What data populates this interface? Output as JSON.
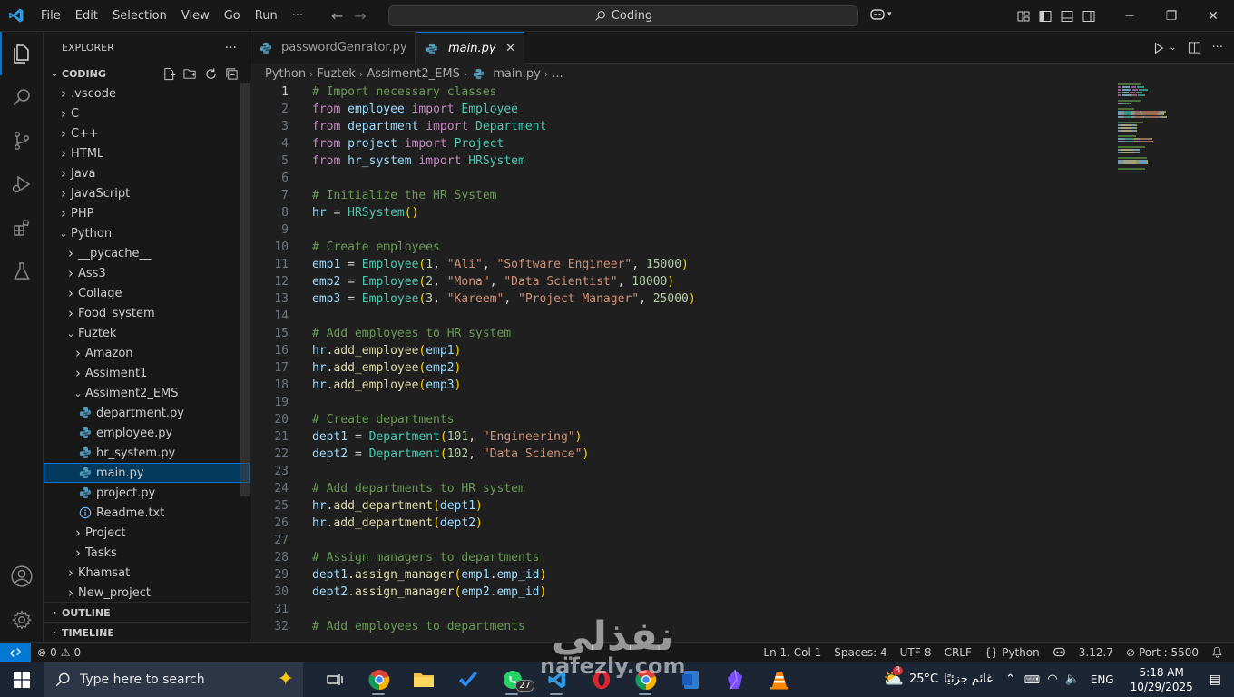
{
  "titlebar": {
    "menu": [
      "File",
      "Edit",
      "Selection",
      "View",
      "Go",
      "Run",
      "···"
    ],
    "command_center": "Coding",
    "window_controls": [
      "minimize-icon",
      "restore-icon",
      "close-icon"
    ]
  },
  "explorer": {
    "title": "EXPLORER",
    "more": "···",
    "root": "CODING",
    "tree": [
      {
        "label": ".vscode",
        "type": "folder",
        "depth": 0,
        "open": false
      },
      {
        "label": "C",
        "type": "folder",
        "depth": 0,
        "open": false
      },
      {
        "label": "C++",
        "type": "folder",
        "depth": 0,
        "open": false
      },
      {
        "label": "HTML",
        "type": "folder",
        "depth": 0,
        "open": false
      },
      {
        "label": "Java",
        "type": "folder",
        "depth": 0,
        "open": false
      },
      {
        "label": "JavaScript",
        "type": "folder",
        "depth": 0,
        "open": false
      },
      {
        "label": "PHP",
        "type": "folder",
        "depth": 0,
        "open": false
      },
      {
        "label": "Python",
        "type": "folder",
        "depth": 0,
        "open": true
      },
      {
        "label": "__pycache__",
        "type": "folder",
        "depth": 1,
        "open": false
      },
      {
        "label": "Ass3",
        "type": "folder",
        "depth": 1,
        "open": false
      },
      {
        "label": "Collage",
        "type": "folder",
        "depth": 1,
        "open": false
      },
      {
        "label": "Food_system",
        "type": "folder",
        "depth": 1,
        "open": false
      },
      {
        "label": "Fuztek",
        "type": "folder",
        "depth": 1,
        "open": true
      },
      {
        "label": "Amazon",
        "type": "folder",
        "depth": 2,
        "open": false
      },
      {
        "label": "Assiment1",
        "type": "folder",
        "depth": 2,
        "open": false
      },
      {
        "label": "Assiment2_EMS",
        "type": "folder",
        "depth": 2,
        "open": true
      },
      {
        "label": "department.py",
        "type": "python",
        "depth": 3
      },
      {
        "label": "employee.py",
        "type": "python",
        "depth": 3
      },
      {
        "label": "hr_system.py",
        "type": "python",
        "depth": 3
      },
      {
        "label": "main.py",
        "type": "python",
        "depth": 3,
        "selected": true
      },
      {
        "label": "project.py",
        "type": "python",
        "depth": 3
      },
      {
        "label": "Readme.txt",
        "type": "text",
        "depth": 3
      },
      {
        "label": "Project",
        "type": "folder",
        "depth": 2,
        "open": false
      },
      {
        "label": "Tasks",
        "type": "folder",
        "depth": 2,
        "open": false
      },
      {
        "label": "Khamsat",
        "type": "folder",
        "depth": 1,
        "open": false
      },
      {
        "label": "New_project",
        "type": "folder",
        "depth": 1,
        "open": false
      }
    ],
    "outline": "OUTLINE",
    "timeline": "TIMELINE"
  },
  "tabs": [
    {
      "label": "passwordGenrator.py",
      "active": false
    },
    {
      "label": "main.py",
      "active": true
    }
  ],
  "breadcrumb": [
    "Python",
    "Fuztek",
    "Assiment2_EMS",
    "main.py",
    "..."
  ],
  "editor": {
    "current_line": 1,
    "lines": [
      [
        [
          "cm",
          "# Import necessary classes"
        ]
      ],
      [
        [
          "kw",
          "from"
        ],
        [
          "op",
          " "
        ],
        [
          "vr",
          "employee"
        ],
        [
          "op",
          " "
        ],
        [
          "kw",
          "import"
        ],
        [
          "op",
          " "
        ],
        [
          "cls",
          "Employee"
        ]
      ],
      [
        [
          "kw",
          "from"
        ],
        [
          "op",
          " "
        ],
        [
          "vr",
          "department"
        ],
        [
          "op",
          " "
        ],
        [
          "kw",
          "import"
        ],
        [
          "op",
          " "
        ],
        [
          "cls",
          "Department"
        ]
      ],
      [
        [
          "kw",
          "from"
        ],
        [
          "op",
          " "
        ],
        [
          "vr",
          "project"
        ],
        [
          "op",
          " "
        ],
        [
          "kw",
          "import"
        ],
        [
          "op",
          " "
        ],
        [
          "cls",
          "Project"
        ]
      ],
      [
        [
          "kw",
          "from"
        ],
        [
          "op",
          " "
        ],
        [
          "vr",
          "hr_system"
        ],
        [
          "op",
          " "
        ],
        [
          "kw",
          "import"
        ],
        [
          "op",
          " "
        ],
        [
          "cls",
          "HRSystem"
        ]
      ],
      [],
      [
        [
          "cm",
          "# Initialize the HR System"
        ]
      ],
      [
        [
          "vr",
          "hr"
        ],
        [
          "op",
          " = "
        ],
        [
          "cls",
          "HRSystem"
        ],
        [
          "p",
          "()"
        ]
      ],
      [],
      [
        [
          "cm",
          "# Create employees"
        ]
      ],
      [
        [
          "vr",
          "emp1"
        ],
        [
          "op",
          " = "
        ],
        [
          "cls",
          "Employee"
        ],
        [
          "p",
          "("
        ],
        [
          "num",
          "1"
        ],
        [
          "op",
          ", "
        ],
        [
          "str",
          "\"Ali\""
        ],
        [
          "op",
          ", "
        ],
        [
          "str",
          "\"Software Engineer\""
        ],
        [
          "op",
          ", "
        ],
        [
          "num",
          "15000"
        ],
        [
          "p",
          ")"
        ]
      ],
      [
        [
          "vr",
          "emp2"
        ],
        [
          "op",
          " = "
        ],
        [
          "cls",
          "Employee"
        ],
        [
          "p",
          "("
        ],
        [
          "num",
          "2"
        ],
        [
          "op",
          ", "
        ],
        [
          "str",
          "\"Mona\""
        ],
        [
          "op",
          ", "
        ],
        [
          "str",
          "\"Data Scientist\""
        ],
        [
          "op",
          ", "
        ],
        [
          "num",
          "18000"
        ],
        [
          "p",
          ")"
        ]
      ],
      [
        [
          "vr",
          "emp3"
        ],
        [
          "op",
          " = "
        ],
        [
          "cls",
          "Employee"
        ],
        [
          "p",
          "("
        ],
        [
          "num",
          "3"
        ],
        [
          "op",
          ", "
        ],
        [
          "str",
          "\"Kareem\""
        ],
        [
          "op",
          ", "
        ],
        [
          "str",
          "\"Project Manager\""
        ],
        [
          "op",
          ", "
        ],
        [
          "num",
          "25000"
        ],
        [
          "p",
          ")"
        ]
      ],
      [],
      [
        [
          "cm",
          "# Add employees to HR system"
        ]
      ],
      [
        [
          "vr",
          "hr"
        ],
        [
          "op",
          "."
        ],
        [
          "fn",
          "add_employee"
        ],
        [
          "p",
          "("
        ],
        [
          "vr",
          "emp1"
        ],
        [
          "p",
          ")"
        ]
      ],
      [
        [
          "vr",
          "hr"
        ],
        [
          "op",
          "."
        ],
        [
          "fn",
          "add_employee"
        ],
        [
          "p",
          "("
        ],
        [
          "vr",
          "emp2"
        ],
        [
          "p",
          ")"
        ]
      ],
      [
        [
          "vr",
          "hr"
        ],
        [
          "op",
          "."
        ],
        [
          "fn",
          "add_employee"
        ],
        [
          "p",
          "("
        ],
        [
          "vr",
          "emp3"
        ],
        [
          "p",
          ")"
        ]
      ],
      [],
      [
        [
          "cm",
          "# Create departments"
        ]
      ],
      [
        [
          "vr",
          "dept1"
        ],
        [
          "op",
          " = "
        ],
        [
          "cls",
          "Department"
        ],
        [
          "p",
          "("
        ],
        [
          "num",
          "101"
        ],
        [
          "op",
          ", "
        ],
        [
          "str",
          "\"Engineering\""
        ],
        [
          "p",
          ")"
        ]
      ],
      [
        [
          "vr",
          "dept2"
        ],
        [
          "op",
          " = "
        ],
        [
          "cls",
          "Department"
        ],
        [
          "p",
          "("
        ],
        [
          "num",
          "102"
        ],
        [
          "op",
          ", "
        ],
        [
          "str",
          "\"Data Science\""
        ],
        [
          "p",
          ")"
        ]
      ],
      [],
      [
        [
          "cm",
          "# Add departments to HR system"
        ]
      ],
      [
        [
          "vr",
          "hr"
        ],
        [
          "op",
          "."
        ],
        [
          "fn",
          "add_department"
        ],
        [
          "p",
          "("
        ],
        [
          "vr",
          "dept1"
        ],
        [
          "p",
          ")"
        ]
      ],
      [
        [
          "vr",
          "hr"
        ],
        [
          "op",
          "."
        ],
        [
          "fn",
          "add_department"
        ],
        [
          "p",
          "("
        ],
        [
          "vr",
          "dept2"
        ],
        [
          "p",
          ")"
        ]
      ],
      [],
      [
        [
          "cm",
          "# Assign managers to departments"
        ]
      ],
      [
        [
          "vr",
          "dept1"
        ],
        [
          "op",
          "."
        ],
        [
          "fn",
          "assign_manager"
        ],
        [
          "p",
          "("
        ],
        [
          "vr",
          "emp1"
        ],
        [
          "op",
          "."
        ],
        [
          "vr",
          "emp_id"
        ],
        [
          "p",
          ")"
        ]
      ],
      [
        [
          "vr",
          "dept2"
        ],
        [
          "op",
          "."
        ],
        [
          "fn",
          "assign_manager"
        ],
        [
          "p",
          "("
        ],
        [
          "vr",
          "emp2"
        ],
        [
          "op",
          "."
        ],
        [
          "vr",
          "emp_id"
        ],
        [
          "p",
          ")"
        ]
      ],
      [],
      [
        [
          "cm",
          "# Add employees to departments"
        ]
      ]
    ]
  },
  "statusbar": {
    "errors": "0",
    "warnings": "0",
    "position": "Ln 1, Col 1",
    "spaces": "Spaces: 4",
    "encoding": "UTF-8",
    "eol": "CRLF",
    "language": "Python",
    "lang_braces": "{}",
    "version": "3.12.7",
    "port": "Port : 5500"
  },
  "taskbar": {
    "search_placeholder": "Type here to search",
    "whatsapp_badge": "27",
    "weather_badge": "3",
    "temperature": "25°C",
    "weather_text": "غائم جزئيًا",
    "language": "ENG",
    "time": "5:18 AM",
    "date": "10/29/2025"
  },
  "watermark": {
    "arabic": "نفذلي",
    "latin": "nafezly.com"
  },
  "colors": {
    "accent": "#0078d4",
    "selection": "#04395e",
    "python_icon": "#519aba"
  }
}
